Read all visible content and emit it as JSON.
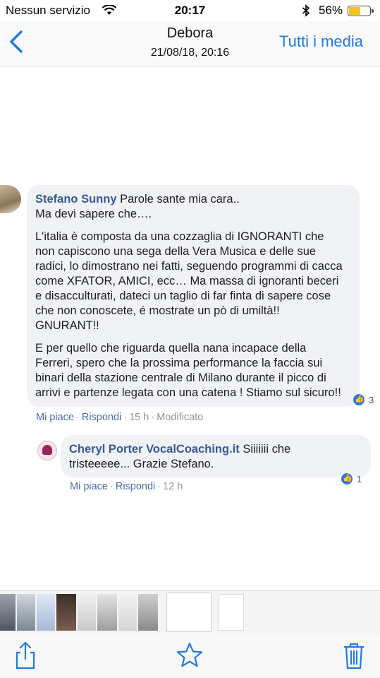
{
  "status": {
    "carrier": "Nessun servizio",
    "time": "20:17",
    "battery": "56%",
    "battery_level": 0.56,
    "battery_color": "#f5c518"
  },
  "nav": {
    "back_icon": "chevron-left-icon",
    "title": "Debora",
    "subtitle": "21/08/18, 20:16",
    "media_link": "Tutti i media"
  },
  "thread": {
    "main_comment": {
      "author": "Stefano Sunny",
      "text_lines": [
        "Parole sante mia cara..\nMa devi sapere che….",
        "L'italia è composta da una cozzaglia di IGNORANTI che\nnon capiscono una sega della Vera Musica e delle sue\nradici, lo dimostrano nei fatti, seguendo programmi di cacca\ncome XFATOR, AMICI, ecc… Ma massa di ignoranti beceri\ne disacculturati, dateci un taglio di far finta di sapere cose\nche non conoscete, é mostrate un pò di umiltà!!\nGNURANT!!",
        "E per quello che riguarda quella nana incapace della\nFerreri, spero che la prossima performance la faccia sui\nbinari della stazione centrale di Milano durante il picco di\narrivi e partenze legata con una catena ! Stiamo sul sicuro!!"
      ],
      "like_count": "3",
      "actions": {
        "like": "Mi piace",
        "reply": "Rispondi",
        "time": "15 h",
        "edited": "Modificato"
      }
    },
    "reply": {
      "author": "Cheryl Porter VocalCoaching.it",
      "text": "Siiiiiii che\ntristeeeee... Grazie Stefano.",
      "like_count": "1",
      "actions": {
        "like": "Mi piace",
        "reply": "Rispondi",
        "time": "12 h"
      }
    }
  },
  "toolbar": {
    "share_icon": "share-icon",
    "favorite_icon": "star-icon",
    "delete_icon": "trash-icon",
    "accent": "#1f7ae0"
  }
}
